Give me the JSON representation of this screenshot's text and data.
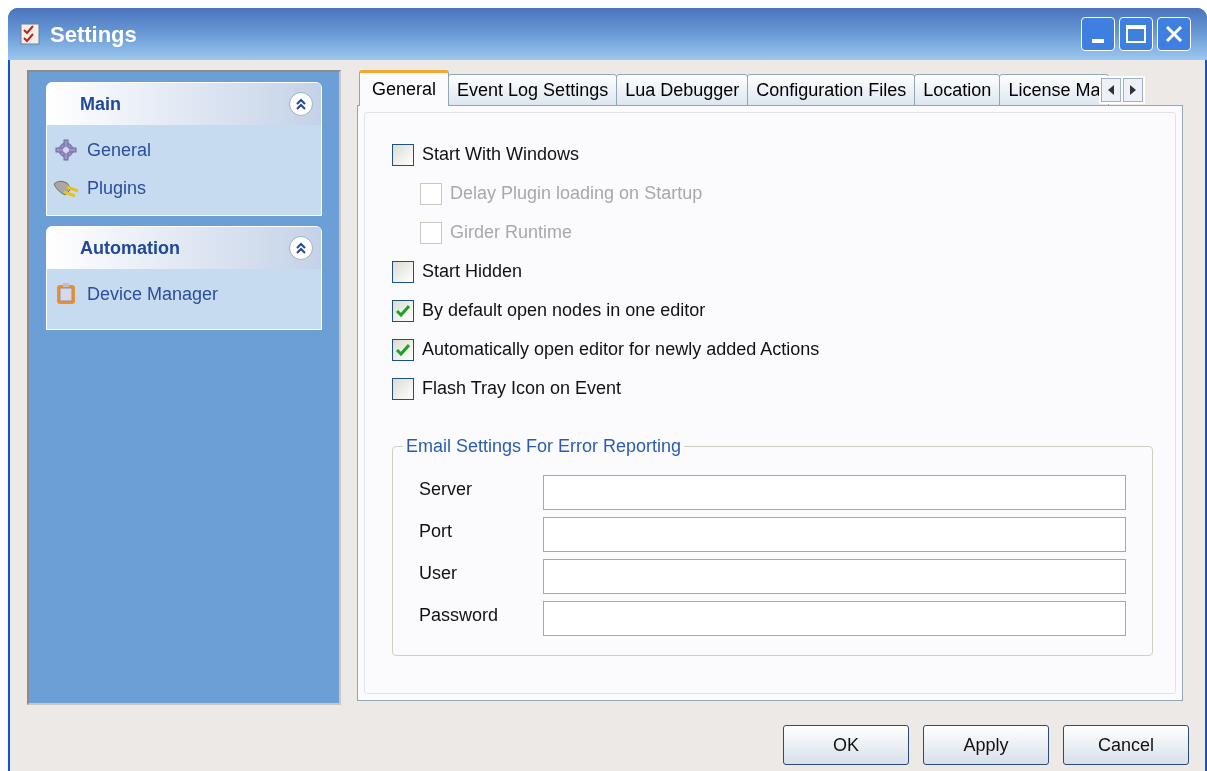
{
  "window": {
    "title": "Settings"
  },
  "sidebar": {
    "groups": [
      {
        "title": "Main",
        "expanded": true,
        "items": [
          {
            "label": "General"
          },
          {
            "label": "Plugins"
          }
        ]
      },
      {
        "title": "Automation",
        "expanded": true,
        "items": [
          {
            "label": "Device Manager"
          }
        ]
      }
    ]
  },
  "tabs": [
    {
      "label": "General",
      "selected": true
    },
    {
      "label": "Event Log Settings",
      "selected": false
    },
    {
      "label": "Lua Debugger",
      "selected": false
    },
    {
      "label": "Configuration Files",
      "selected": false
    },
    {
      "label": "Location",
      "selected": false
    },
    {
      "label": "License Ma",
      "selected": false
    }
  ],
  "options": [
    {
      "label": "Start With Windows",
      "checked": false,
      "disabled": false,
      "children": [
        {
          "label": "Delay Plugin loading on Startup",
          "checked": false,
          "disabled": true
        },
        {
          "label": "Girder Runtime",
          "checked": false,
          "disabled": true
        }
      ]
    },
    {
      "label": "Start Hidden",
      "checked": false,
      "disabled": false
    },
    {
      "label": "By default open nodes in one editor",
      "checked": true,
      "disabled": false
    },
    {
      "label": "Automatically open editor for newly added Actions",
      "checked": true,
      "disabled": false
    },
    {
      "label": "Flash Tray Icon on Event",
      "checked": false,
      "disabled": false
    }
  ],
  "email_settings": {
    "title": "Email Settings For Error Reporting",
    "fields": [
      {
        "label": "Server"
      },
      {
        "label": "Port"
      },
      {
        "label": "User"
      },
      {
        "label": "Password"
      }
    ]
  },
  "buttons": [
    "OK",
    "Apply",
    "Cancel"
  ]
}
